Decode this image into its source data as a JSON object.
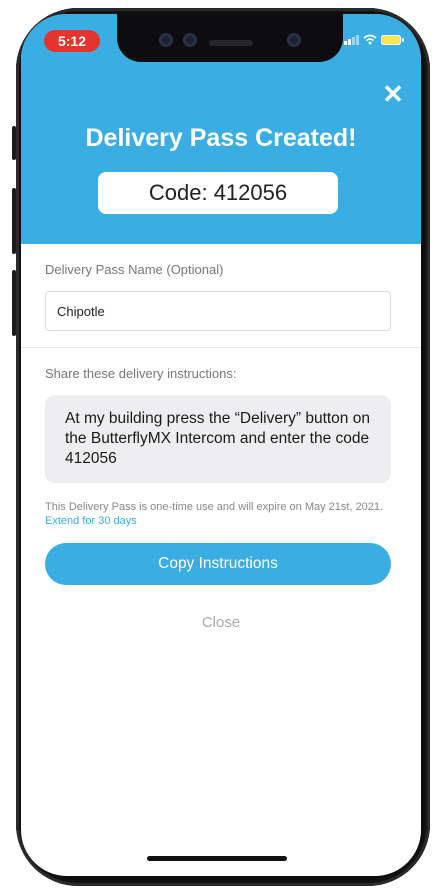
{
  "status_bar": {
    "time": "5:12"
  },
  "header": {
    "close_icon": "close-icon",
    "close_glyph": "✕",
    "title": "Delivery Pass Created!",
    "code_text": "Code: 412056"
  },
  "form": {
    "name_label": "Delivery Pass Name (Optional)",
    "name_value": "Chipotle"
  },
  "share": {
    "label": "Share these delivery instructions:",
    "instructions": "At my building press the “Delivery” button on the ButterflyMX Intercom and enter the code 412056"
  },
  "expiry": {
    "text": "This Delivery Pass is one-time use and will expire on May 21st, 2021. ",
    "extend_link": "Extend for 30 days"
  },
  "actions": {
    "copy_label": "Copy Instructions",
    "close_label": "Close"
  },
  "colors": {
    "accent": "#3aaee3",
    "time_pill": "#e5342d"
  }
}
